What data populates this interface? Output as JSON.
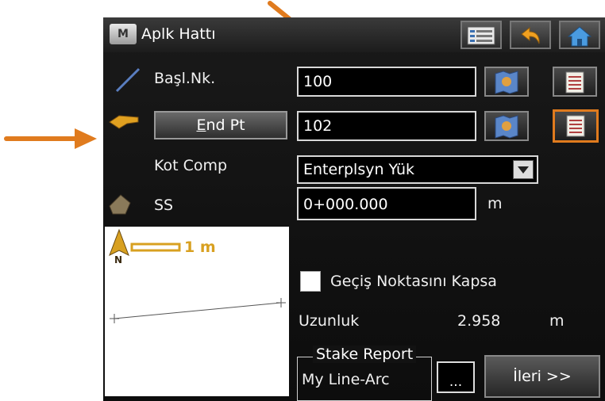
{
  "window": {
    "title": "Aplk Hattı",
    "badge": "M"
  },
  "fields": {
    "start_label": "Başl.Nk.",
    "start_value": "100",
    "end_button": "End Pt",
    "end_value": "102",
    "kot_label": "Kot Comp",
    "kot_value": "Enterplsyn Yük",
    "ss_label": "SS",
    "ss_value": "0+000.000",
    "ss_unit": "m"
  },
  "map": {
    "scale": "1 m",
    "north": "N"
  },
  "options": {
    "cover_label": "Geçiş Noktasını Kapsa",
    "length_label": "Uzunluk",
    "length_value": "2.958",
    "length_unit": "m"
  },
  "stake_report": {
    "title": "Stake Report",
    "value": "My Line-Arc",
    "browse": "..."
  },
  "next_button": "İleri >>",
  "colors": {
    "highlight": "#e07b1e",
    "background": "#121212"
  },
  "icons": [
    "list-icon",
    "back-icon",
    "home-icon",
    "map-pick-icon",
    "list-pick-icon",
    "arrow-annotation-icon"
  ]
}
